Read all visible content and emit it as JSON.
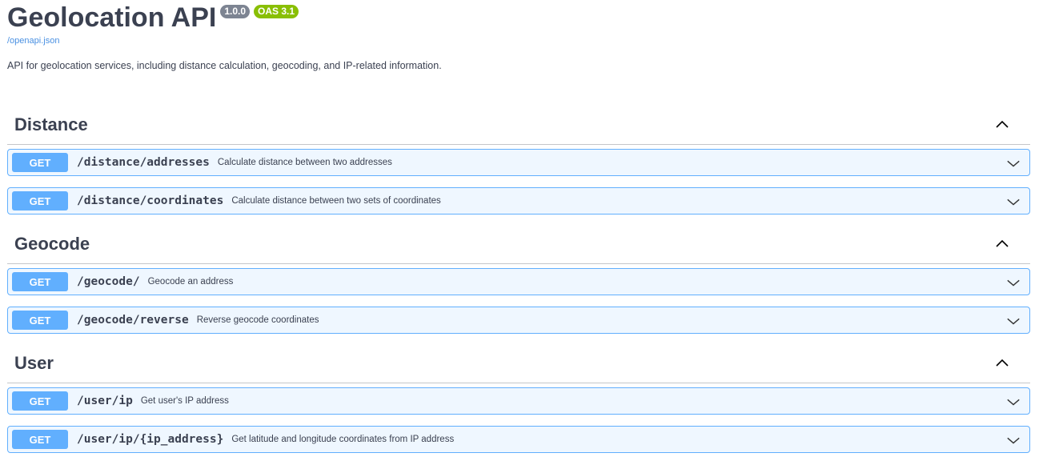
{
  "header": {
    "title": "Geolocation API",
    "version_badge": "1.0.0",
    "oas_badge": "OAS 3.1",
    "spec_link": "/openapi.json",
    "description": "API for geolocation services, including distance calculation, geocoding, and IP-related information."
  },
  "sections": [
    {
      "name": "Distance",
      "operations": [
        {
          "method": "GET",
          "path": "/distance/addresses",
          "summary": "Calculate distance between two addresses"
        },
        {
          "method": "GET",
          "path": "/distance/coordinates",
          "summary": "Calculate distance between two sets of coordinates"
        }
      ]
    },
    {
      "name": "Geocode",
      "operations": [
        {
          "method": "GET",
          "path": "/geocode/",
          "summary": "Geocode an address"
        },
        {
          "method": "GET",
          "path": "/geocode/reverse",
          "summary": "Reverse geocode coordinates"
        }
      ]
    },
    {
      "name": "User",
      "operations": [
        {
          "method": "GET",
          "path": "/user/ip",
          "summary": "Get user's IP address"
        },
        {
          "method": "GET",
          "path": "/user/ip/{ip_address}",
          "summary": "Get latitude and longitude coordinates from IP address"
        }
      ]
    }
  ],
  "colors": {
    "get_accent": "#61affe",
    "version_badge": "#7d8492",
    "oas_badge": "#89bf04",
    "link": "#4990e2"
  },
  "icons": {
    "section_toggle": "chevron-up-icon",
    "operation_toggle": "chevron-down-icon"
  }
}
